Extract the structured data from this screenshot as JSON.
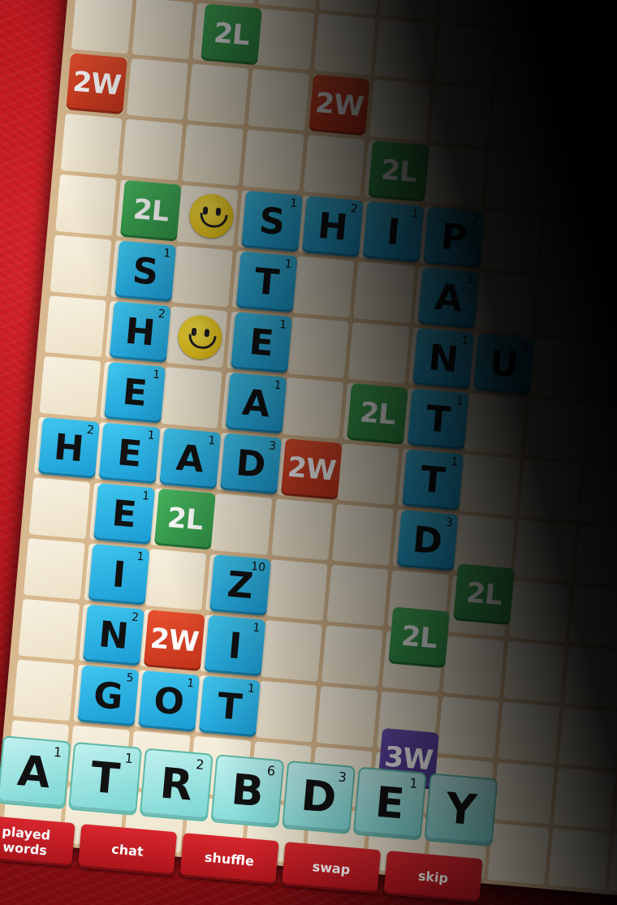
{
  "premium_labels": {
    "l2": "2L",
    "w2": "2W",
    "w3": "3W"
  },
  "board": {
    "tiles": [
      {
        "letter": "S",
        "points": "1"
      },
      {
        "letter": "H",
        "points": "2"
      },
      {
        "letter": "I",
        "points": "1"
      },
      {
        "letter": "P",
        "points": "2"
      },
      {
        "letter": "S",
        "points": "1"
      },
      {
        "letter": "T",
        "points": "1"
      },
      {
        "letter": "A",
        "points": "1"
      },
      {
        "letter": "H",
        "points": "2"
      },
      {
        "letter": "E",
        "points": "1"
      },
      {
        "letter": "N",
        "points": "1"
      },
      {
        "letter": "U",
        "points": "1"
      },
      {
        "letter": "E",
        "points": "1"
      },
      {
        "letter": "A",
        "points": "1"
      },
      {
        "letter": "T",
        "points": "1"
      },
      {
        "letter": "H",
        "points": "2"
      },
      {
        "letter": "E",
        "points": "1"
      },
      {
        "letter": "A",
        "points": "1"
      },
      {
        "letter": "D",
        "points": "3"
      },
      {
        "letter": "T",
        "points": "1"
      },
      {
        "letter": "E",
        "points": "1"
      },
      {
        "letter": "D",
        "points": "3"
      },
      {
        "letter": "I",
        "points": "1"
      },
      {
        "letter": "Z",
        "points": "10"
      },
      {
        "letter": "N",
        "points": "2"
      },
      {
        "letter": "I",
        "points": "1"
      },
      {
        "letter": "G",
        "points": "5"
      },
      {
        "letter": "O",
        "points": "1"
      },
      {
        "letter": "T",
        "points": "1"
      }
    ]
  },
  "rack": {
    "tiles": [
      {
        "letter": "A",
        "points": "1"
      },
      {
        "letter": "T",
        "points": "1"
      },
      {
        "letter": "R",
        "points": "2"
      },
      {
        "letter": "B",
        "points": "6"
      },
      {
        "letter": "D",
        "points": "3"
      },
      {
        "letter": "E",
        "points": "1"
      },
      {
        "letter": "Y",
        "points": ""
      }
    ]
  },
  "toolbar": {
    "played_words_line1": "played",
    "played_words_line2": "words",
    "chat": "chat",
    "shuffle": "shuffle",
    "swap": "swap",
    "skip": "skip"
  },
  "colors": {
    "tile_blue": "#2bb3e3",
    "rack_tile": "#a6e6e3",
    "premium_2l": "#3fa954",
    "premium_2w": "#d9402a",
    "premium_3w": "#5a40a6",
    "background_red": "#c41e24",
    "board_tan": "#d8b88e"
  },
  "icons": [
    "smiley-icon"
  ]
}
